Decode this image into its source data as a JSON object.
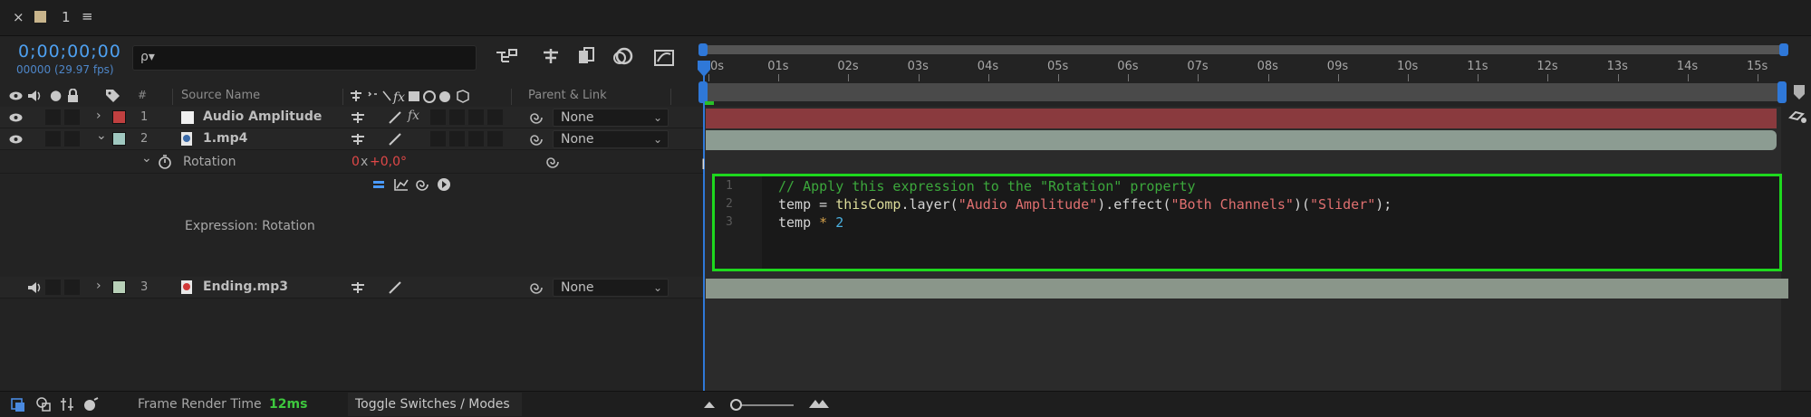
{
  "tab": {
    "close": "×",
    "name": "1",
    "menu": "≡"
  },
  "header": {
    "timecode": "0;00;00;00",
    "fps": "00000 (29.97 fps)",
    "search_icon": "ρ▾"
  },
  "columns": {
    "hash": "#",
    "source_name": "Source Name",
    "parent_link": "Parent & Link"
  },
  "ruler": {
    "ticks": [
      "0s",
      "01s",
      "02s",
      "03s",
      "04s",
      "05s",
      "06s",
      "07s",
      "08s",
      "09s",
      "10s",
      "11s",
      "12s",
      "13s",
      "14s",
      "15s"
    ]
  },
  "layers": [
    {
      "num": "1",
      "name": "Audio Amplitude",
      "label_color": "#c04040",
      "parent": "None",
      "fx": "fx"
    },
    {
      "num": "2",
      "name": "1.mp4",
      "label_color": "#a0c8c0",
      "parent": "None"
    },
    {
      "num": "3",
      "name": "Ending.mp3",
      "label_color": "#b8d0b8",
      "parent": "None"
    }
  ],
  "property": {
    "name": "Rotation",
    "value_a": "0",
    "value_x": "x",
    "value_b": "+0,0°"
  },
  "expression": {
    "label": "Expression: Rotation",
    "lines": [
      "1",
      "2",
      "3"
    ],
    "line1_comment": "// Apply this expression to the \"Rotation\" property",
    "line2_a": "temp = ",
    "line2_b": "thisComp",
    "line2_c": ".layer(",
    "line2_d": "\"Audio Amplitude\"",
    "line2_e": ").effect(",
    "line2_f": "\"Both Channels\"",
    "line2_g": ")(",
    "line2_h": "\"Slider\"",
    "line2_i": ");",
    "line3_a": "temp ",
    "line3_b": "*",
    "line3_c": " 2"
  },
  "bottom": {
    "render_label": "Frame Render Time",
    "render_value": "12ms",
    "toggle": "Toggle Switches / Modes"
  },
  "colors": {
    "accent": "#2f78d8",
    "track1": "#8a3a3e",
    "track2": "#8c9c92",
    "track3": "#8a968a",
    "expr_border": "#1ed81e"
  }
}
